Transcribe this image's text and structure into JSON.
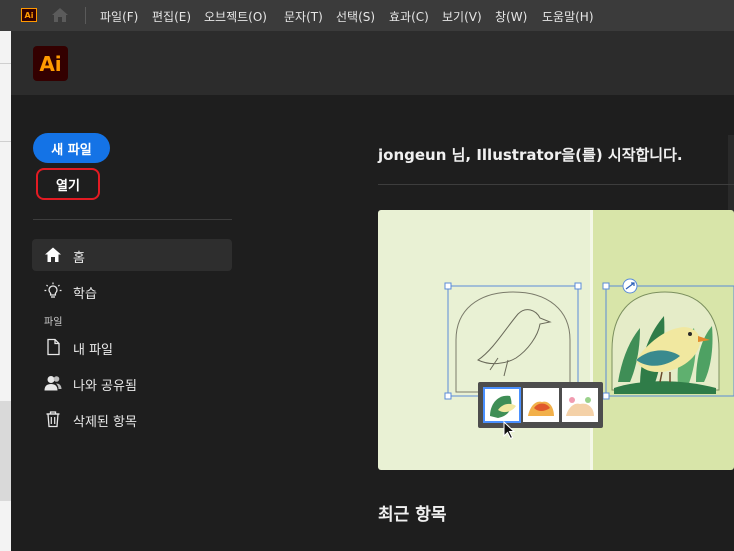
{
  "menubar": {
    "logo": "Ai",
    "items": [
      "파일(F)",
      "편집(E)",
      "오브젝트(O)",
      "문자(T)",
      "선택(S)",
      "효과(C)",
      "보기(V)",
      "창(W)",
      "도움말(H)"
    ]
  },
  "header": {
    "logo": "Ai"
  },
  "sidebar": {
    "new_file": "새 파일",
    "open": "열기",
    "nav": [
      {
        "label": "홈",
        "icon": "home-icon"
      },
      {
        "label": "학습",
        "icon": "lightbulb-icon"
      }
    ],
    "section_files": "파일",
    "files": [
      {
        "label": "내 파일",
        "icon": "document-icon"
      },
      {
        "label": "나와 공유됨",
        "icon": "people-icon"
      },
      {
        "label": "삭제된 항목",
        "icon": "trash-icon"
      }
    ]
  },
  "main": {
    "greeting": "jongeun 님, Illustrator을(를) 시작합니다.",
    "recent_title": "최근 항목"
  },
  "colors": {
    "accent_blue": "#1473e6",
    "highlight_red": "#e31b23",
    "ai_orange": "#ff9a00"
  }
}
